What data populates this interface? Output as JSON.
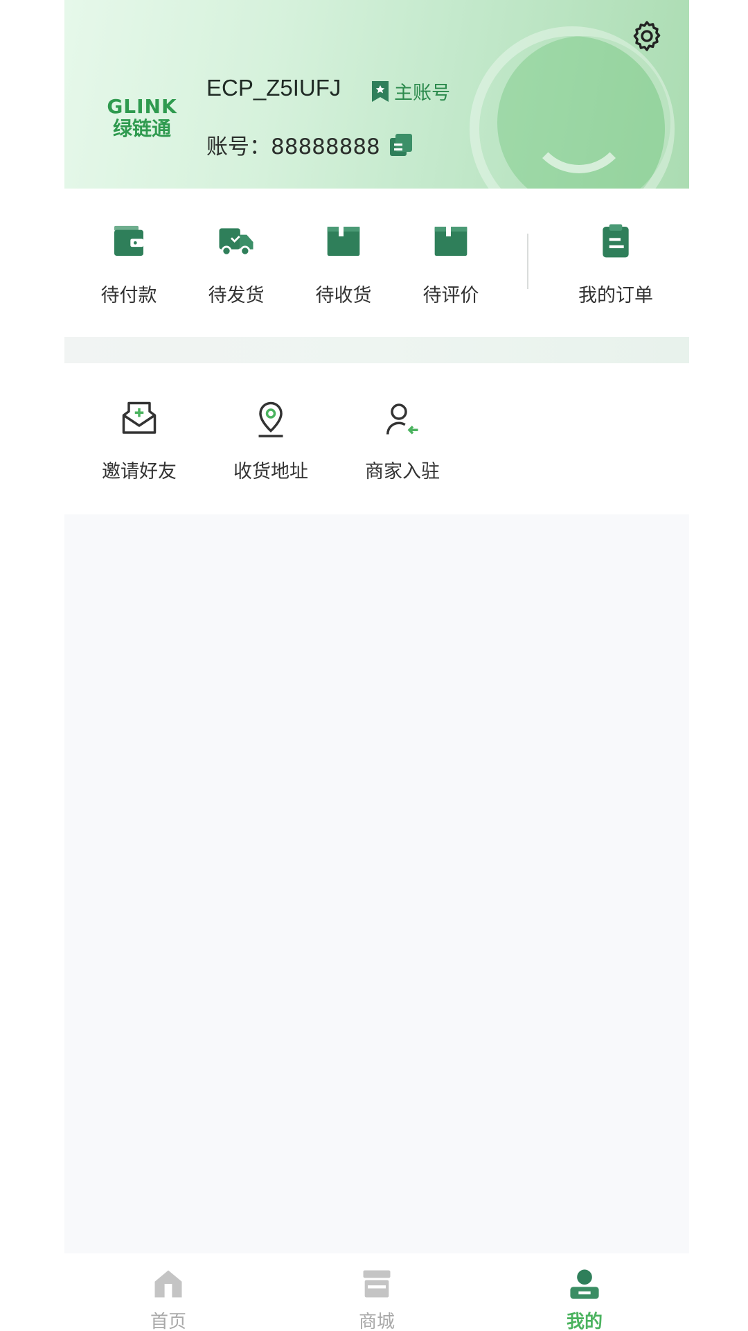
{
  "header": {
    "logo_en": "GLINK",
    "logo_cn": "绿链通",
    "username": "ECP_Z5IUFJ",
    "badge_label": "主账号",
    "account_label": "账号：88888888"
  },
  "orders": {
    "items": [
      {
        "label": "待付款",
        "icon": "wallet-icon"
      },
      {
        "label": "待发货",
        "icon": "truck-icon"
      },
      {
        "label": "待收货",
        "icon": "box-icon"
      },
      {
        "label": "待评价",
        "icon": "box-icon"
      }
    ],
    "my_orders_label": "我的订单"
  },
  "services": {
    "items": [
      {
        "label": "邀请好友",
        "icon": "invite-mail-icon"
      },
      {
        "label": "收货地址",
        "icon": "location-pin-icon"
      },
      {
        "label": "商家入驻",
        "icon": "merchant-user-icon"
      }
    ]
  },
  "tabbar": {
    "tabs": [
      {
        "label": "首页",
        "icon": "home-icon",
        "active": false
      },
      {
        "label": "商城",
        "icon": "store-icon",
        "active": false
      },
      {
        "label": "我的",
        "icon": "profile-icon",
        "active": true
      }
    ]
  },
  "colors": {
    "accent": "#4bb35f",
    "icon_green": "#2f7f5a",
    "header_gradient_start": "#e6f8ea",
    "header_gradient_end": "#abdcb2",
    "tab_inactive": "#a9a9a9"
  }
}
